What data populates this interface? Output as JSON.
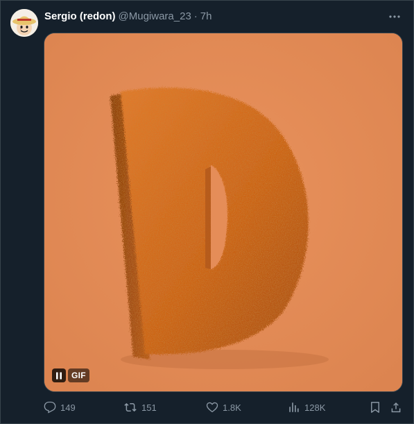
{
  "tweet": {
    "display_name": "Sergio (redon)",
    "handle": "@Mugiwara_23",
    "separator": "·",
    "time": "7h",
    "avatar_icon": "straw-hat-avatar"
  },
  "media": {
    "type_label": "GIF",
    "background_color": "#e38a54",
    "subject": "furry-letter-D"
  },
  "actions": {
    "replies": "149",
    "retweets": "151",
    "likes": "1.8K",
    "views": "128K"
  },
  "colors": {
    "background": "#15202b",
    "secondary_text": "#8b98a5",
    "border": "#38444d"
  }
}
